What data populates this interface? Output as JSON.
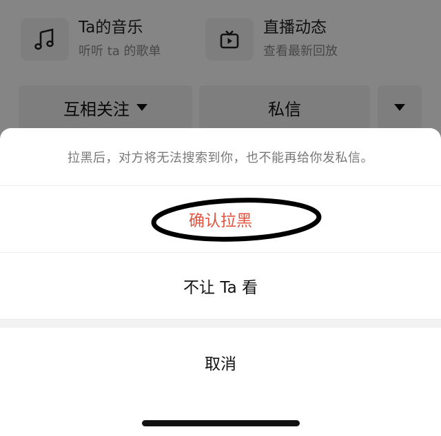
{
  "profile": {
    "music_card": {
      "title": "Ta的音乐",
      "subtitle": "听听 ta 的歌单",
      "icon": "music-note-icon"
    },
    "live_card": {
      "title": "直播动态",
      "subtitle": "查看最新回放",
      "icon": "tv-icon"
    },
    "follow_button": "互相关注",
    "message_button": "私信",
    "more_icon": "caret-down-icon"
  },
  "sheet": {
    "notice": "拉黑后，对方将无法搜索到你，也不能再给你发私信。",
    "confirm_block": "确认拉黑",
    "hide_from": "不让 Ta 看",
    "cancel": "取消"
  },
  "colors": {
    "danger": "#e0533f",
    "annotation_circle": "#000000"
  }
}
